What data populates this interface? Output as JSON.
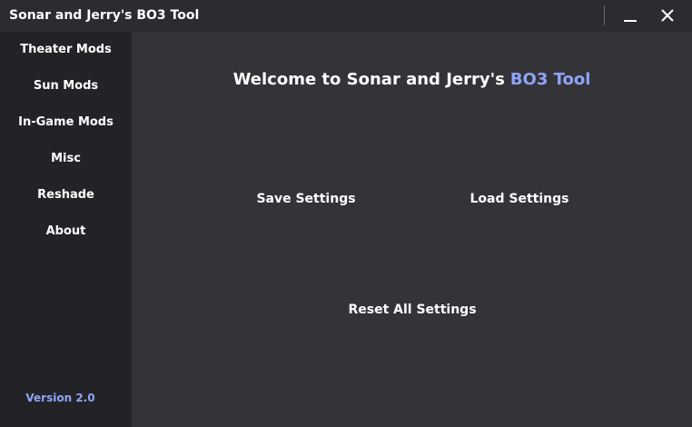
{
  "window": {
    "title": "Sonar and Jerry's BO3 Tool"
  },
  "titlebar_buttons": {
    "minimize_icon": "minimize-icon",
    "close_icon": "close-icon"
  },
  "sidebar": {
    "items": [
      {
        "label": "Theater Mods"
      },
      {
        "label": "Sun Mods"
      },
      {
        "label": "In-Game Mods"
      },
      {
        "label": "Misc"
      },
      {
        "label": "Reshade"
      },
      {
        "label": "About"
      }
    ],
    "version": "Version 2.0"
  },
  "main": {
    "welcome_prefix": "Welcome to Sonar and Jerry's",
    "welcome_accent": "BO3 Tool",
    "save_label": "Save Settings",
    "load_label": "Load Settings",
    "reset_label": "Reset All Settings"
  },
  "colors": {
    "accent": "#8ea4f5",
    "background": "#333338",
    "sidebar": "#232327",
    "titlebar": "#2b2b30"
  }
}
